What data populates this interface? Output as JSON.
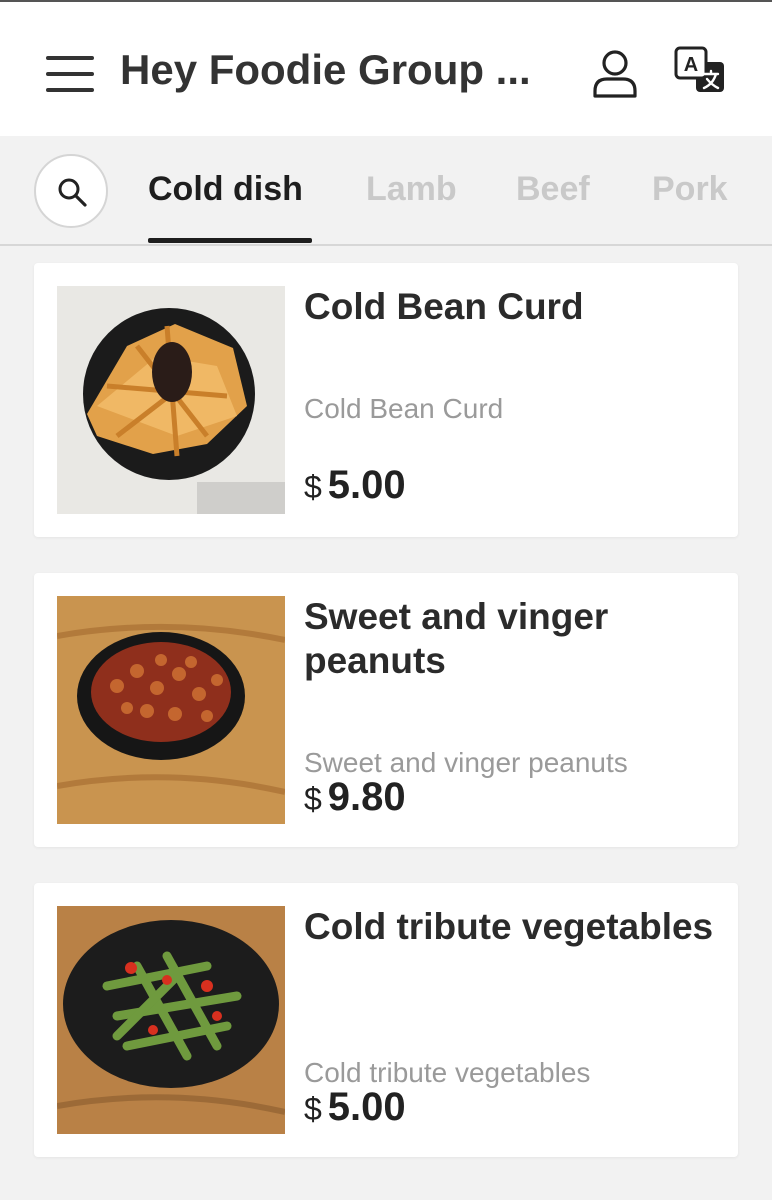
{
  "header": {
    "title": "Hey Foodie Group ...",
    "menu_icon": "hamburger-menu-icon",
    "user_icon": "user-profile-icon",
    "language_icon": "translate-icon"
  },
  "tabs": {
    "search_icon": "search-icon",
    "items": [
      {
        "label": "Cold dish",
        "active": true
      },
      {
        "label": "Lamb",
        "active": false
      },
      {
        "label": "Beef",
        "active": false
      },
      {
        "label": "Pork",
        "active": false
      }
    ]
  },
  "dishes": [
    {
      "name": "Cold Bean Curd",
      "description": "Cold Bean Curd",
      "currency": "$",
      "price": "5.00"
    },
    {
      "name": "Sweet and vinger peanuts",
      "description": "Sweet and vinger peanuts",
      "currency": "$",
      "price": "9.80"
    },
    {
      "name": "Cold tribute vegetables",
      "description": "Cold tribute vegetables",
      "currency": "$",
      "price": "5.00"
    }
  ],
  "colors": {
    "background": "#f2f2f2",
    "card": "#ffffff",
    "active_tab": "#1e1e1e",
    "inactive_tab": "#c9c9c9",
    "muted_text": "#9a9a9a"
  }
}
